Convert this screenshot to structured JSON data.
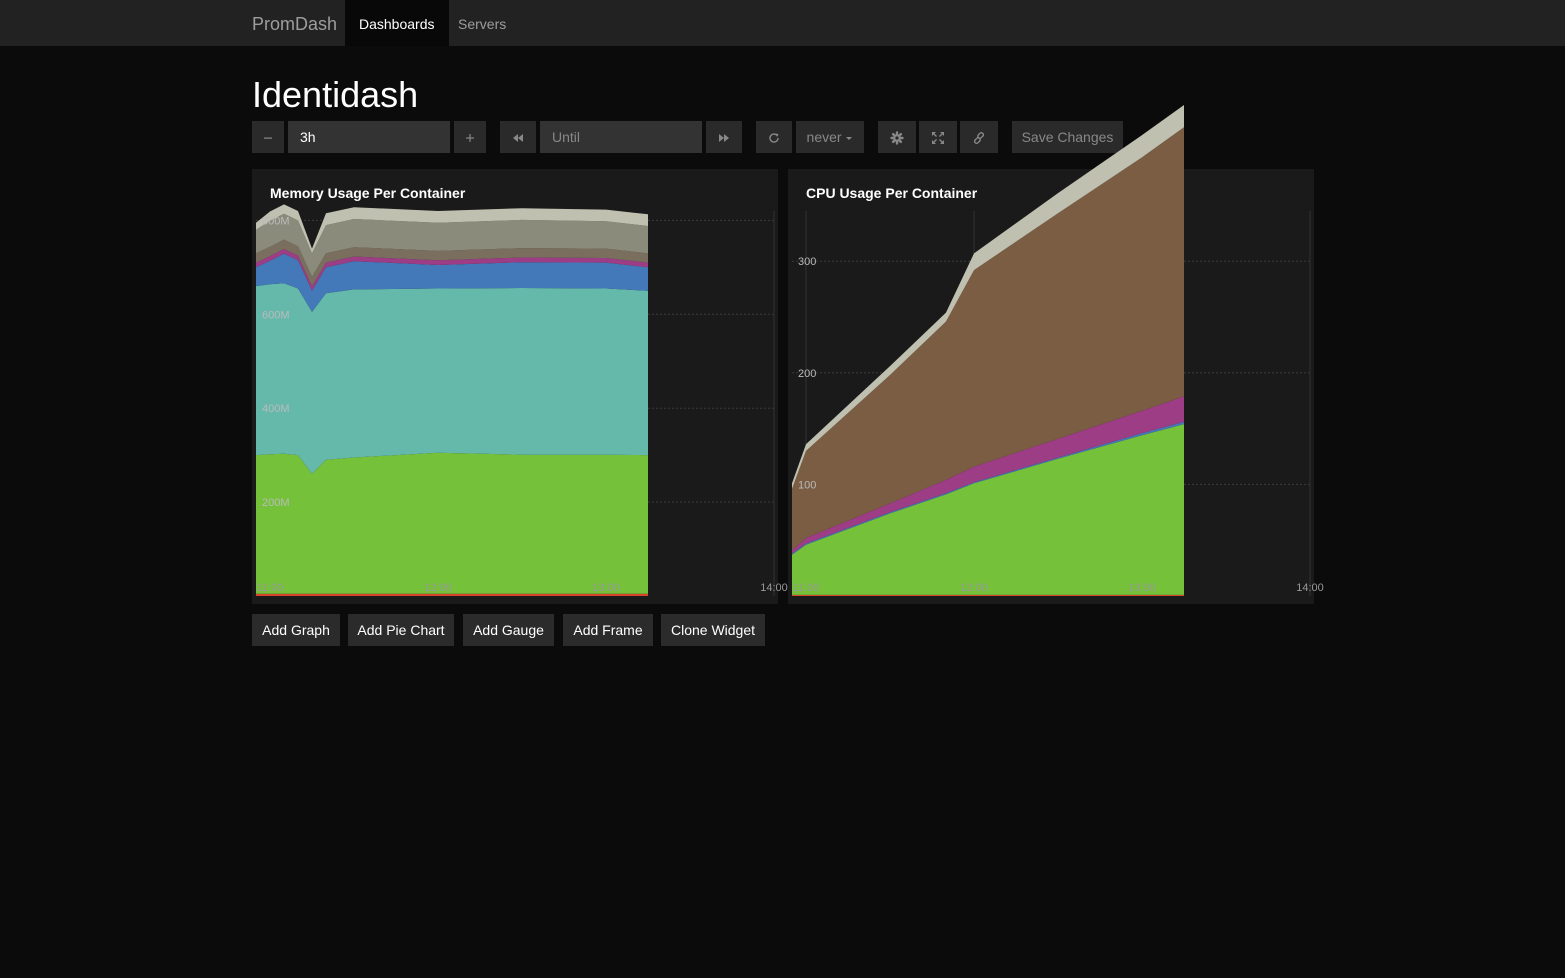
{
  "nav": {
    "brand": "PromDash",
    "items": [
      {
        "label": "Dashboards",
        "active": true
      },
      {
        "label": "Servers",
        "active": false
      }
    ]
  },
  "dashboard": {
    "title": "Identidash"
  },
  "toolbar": {
    "range_value": "3h",
    "until_placeholder": "Until",
    "refresh_label": "never",
    "save_label": "Save Changes",
    "icons": {
      "decrease": "minus-icon",
      "increase": "plus-icon",
      "back": "rewind-icon",
      "forward": "fast-forward-icon",
      "refresh": "refresh-icon",
      "refresh_menu": "caret-down-icon",
      "settings": "gear-icon",
      "fullscreen": "fullscreen-icon",
      "link": "link-icon"
    }
  },
  "widgets": [
    {
      "title": "Memory Usage Per Container"
    },
    {
      "title": "CPU Usage Per Container"
    }
  ],
  "actions": [
    "Add Graph",
    "Add Pie Chart",
    "Add Gauge",
    "Add Frame",
    "Clone Widget"
  ],
  "chart_data": [
    {
      "type": "area",
      "stacked": true,
      "title": "Memory Usage Per Container",
      "xlabel": "",
      "ylabel": "",
      "xlim": [
        "10:55",
        "14:00"
      ],
      "ylim": [
        0,
        820000000
      ],
      "x_ticks": [
        "11:00",
        "12:00",
        "13:00",
        "14:00"
      ],
      "y_ticks": [
        {
          "value": 200000000,
          "label": "200M"
        },
        {
          "value": 400000000,
          "label": "400M"
        },
        {
          "value": 600000000,
          "label": "600M"
        },
        {
          "value": 800000000,
          "label": "800M"
        }
      ],
      "grid": true,
      "colors": [
        "#d9442d",
        "#75c13a",
        "#64b9ab",
        "#4379b8",
        "#9c3d86",
        "#7a6f5f",
        "#8b8b7c",
        "#c0c0b0"
      ],
      "x": [
        "10:55",
        "11:00",
        "11:05",
        "11:10",
        "11:15",
        "11:20",
        "11:30",
        "12:00",
        "12:30",
        "13:00",
        "13:15"
      ],
      "series": [
        {
          "values": [
            5000000,
            5000000,
            5000000,
            5000000,
            5000000,
            5000000,
            5000000,
            5000000,
            5000000,
            5000000,
            5000000
          ]
        },
        {
          "values": [
            295000000,
            297000000,
            298000000,
            295000000,
            255000000,
            285000000,
            290000000,
            300000000,
            296000000,
            296000000,
            295000000
          ]
        },
        {
          "values": [
            360000000,
            362000000,
            363000000,
            355000000,
            345000000,
            355000000,
            358000000,
            350000000,
            355000000,
            354000000,
            350000000
          ]
        },
        {
          "values": [
            40000000,
            50000000,
            63000000,
            60000000,
            45000000,
            55000000,
            60000000,
            50000000,
            55000000,
            55000000,
            50000000
          ]
        },
        {
          "values": [
            10000000,
            10000000,
            10000000,
            10000000,
            10000000,
            10000000,
            10000000,
            10000000,
            10000000,
            10000000,
            10000000
          ]
        },
        {
          "values": [
            20000000,
            20000000,
            20000000,
            20000000,
            20000000,
            20000000,
            20000000,
            20000000,
            20000000,
            20000000,
            20000000
          ]
        },
        {
          "values": [
            50000000,
            55000000,
            55000000,
            55000000,
            50000000,
            60000000,
            60000000,
            60000000,
            60000000,
            58000000,
            58000000
          ]
        },
        {
          "values": [
            15000000,
            20000000,
            20000000,
            20000000,
            10000000,
            25000000,
            25000000,
            25000000,
            25000000,
            25000000,
            25000000
          ]
        }
      ]
    },
    {
      "type": "area",
      "stacked": true,
      "title": "CPU Usage Per Container",
      "xlabel": "",
      "ylabel": "",
      "xlim": [
        "10:55",
        "14:00"
      ],
      "ylim": [
        0,
        345
      ],
      "x_ticks": [
        "11:00",
        "12:00",
        "13:00",
        "14:00"
      ],
      "y_ticks": [
        {
          "value": 100,
          "label": "100"
        },
        {
          "value": 200,
          "label": "200"
        },
        {
          "value": 300,
          "label": "300"
        }
      ],
      "grid": true,
      "colors": [
        "#d9442d",
        "#75c13a",
        "#4379b8",
        "#9c3d86",
        "#7a5d43",
        "#c0c0b0"
      ],
      "x": [
        "10:55",
        "11:00",
        "11:30",
        "11:50",
        "12:00",
        "12:30",
        "13:00",
        "13:15"
      ],
      "series": [
        {
          "values": [
            1,
            1,
            1,
            1,
            1,
            1,
            1,
            1
          ]
        },
        {
          "values": [
            36,
            45,
            73,
            90,
            100,
            122,
            143,
            153
          ]
        },
        {
          "values": [
            1,
            1,
            1,
            1,
            1,
            1,
            2,
            2
          ]
        },
        {
          "values": [
            3,
            5,
            8,
            12,
            14,
            17,
            20,
            23
          ]
        },
        {
          "values": [
            55,
            78,
            115,
            142,
            176,
            202,
            227,
            241
          ]
        },
        {
          "values": [
            5,
            6,
            8,
            8,
            15,
            18,
            20,
            20
          ]
        }
      ]
    }
  ]
}
